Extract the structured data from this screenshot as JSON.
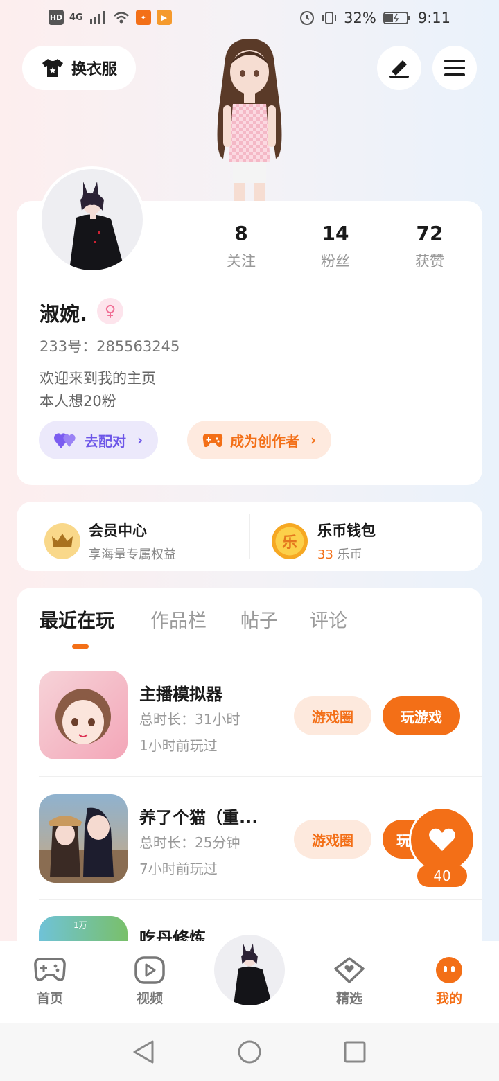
{
  "status_bar": {
    "left_icons": [
      "HD",
      "4G",
      "signal-icon",
      "wifi-icon",
      "app-icon-1",
      "app-icon-2"
    ],
    "battery": "32%",
    "time": "9:11"
  },
  "header": {
    "outfit_label": "换衣服"
  },
  "profile": {
    "stats": [
      {
        "num": "8",
        "label": "关注"
      },
      {
        "num": "14",
        "label": "粉丝"
      },
      {
        "num": "72",
        "label": "获赞"
      }
    ],
    "username": "淑婉.",
    "gender_symbol": "♀",
    "uid_label": "233号：",
    "uid": "285563245",
    "bio_line1": "欢迎来到我的主页",
    "bio_line2": "本人想20粉",
    "match_label": "去配对",
    "creator_label": "成为创作者"
  },
  "vip": {
    "title": "会员中心",
    "subtitle": "享海量专属权益",
    "wallet_title": "乐币钱包",
    "wallet_amount": "33",
    "wallet_unit": "乐币",
    "wallet_coin_char": "乐"
  },
  "tabs": [
    {
      "label": "最近在玩"
    },
    {
      "label": "作品栏"
    },
    {
      "label": "帖子"
    },
    {
      "label": "评论"
    }
  ],
  "games": [
    {
      "name": "主播模拟器",
      "duration": "总时长：31小时",
      "last_played": "1小时前玩过",
      "circle_label": "游戏圈",
      "play_label": "玩游戏"
    },
    {
      "name": "养了个猫（重...",
      "duration": "总时长：25分钟",
      "last_played": "7小时前玩过",
      "circle_label": "游戏圈",
      "play_label": "玩游戏"
    },
    {
      "name": "吃丹修炼",
      "thumb_text": "1万"
    }
  ],
  "like": {
    "count": "40"
  },
  "bottom_nav": [
    {
      "label": "首页"
    },
    {
      "label": "视频"
    },
    {
      "label": "精选"
    },
    {
      "label": "我的"
    }
  ],
  "colors": {
    "accent": "#f36f17",
    "purple": "#7b5cf0"
  }
}
